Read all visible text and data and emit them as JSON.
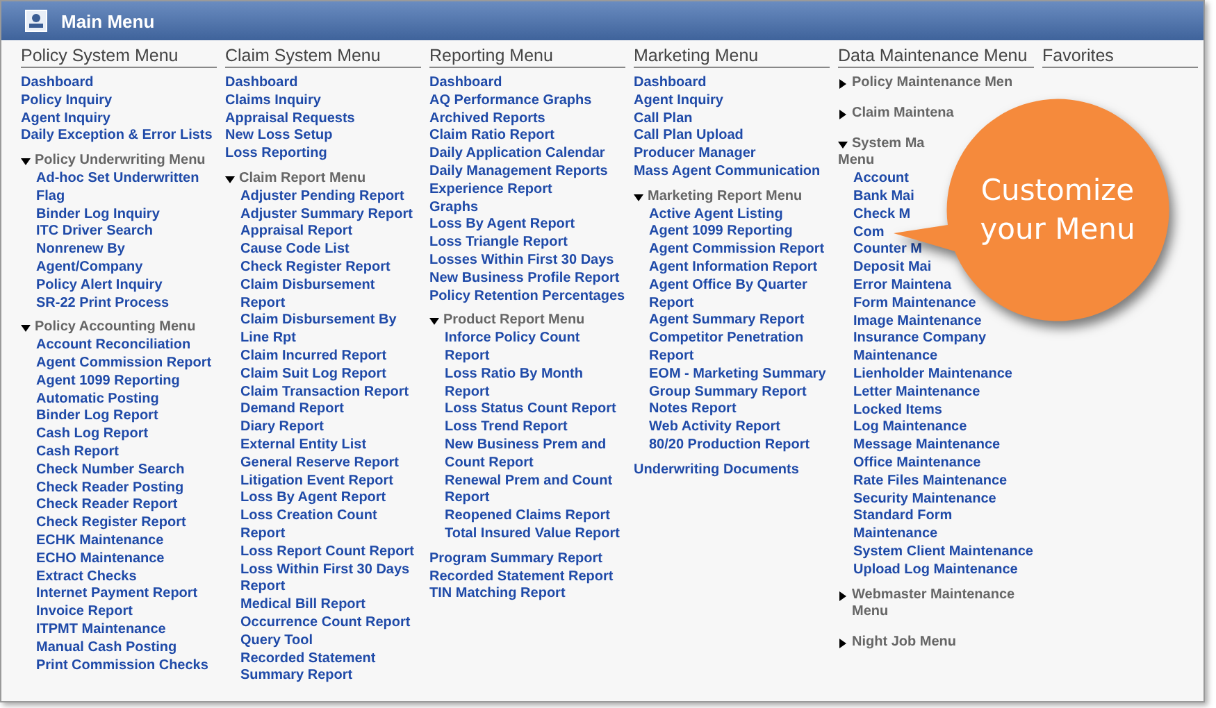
{
  "window": {
    "title": "Main Menu"
  },
  "columns": [
    {
      "title": "Policy System Menu",
      "items": [
        {
          "kind": "link",
          "label": "Dashboard"
        },
        {
          "kind": "link",
          "label": "Policy Inquiry"
        },
        {
          "kind": "link",
          "label": "Agent Inquiry"
        },
        {
          "kind": "link",
          "label": "Daily Exception & Error Lists"
        },
        {
          "kind": "submenu",
          "label": "Policy Underwriting Menu",
          "expanded": true,
          "children": [
            "Ad-hoc Set Underwritten Flag",
            "Binder Log Inquiry",
            "ITC Driver Search",
            "Nonrenew By Agent/Company",
            "Policy Alert Inquiry",
            "SR-22 Print Process"
          ]
        },
        {
          "kind": "submenu",
          "label": "Policy Accounting Menu",
          "expanded": true,
          "children": [
            "Account Reconciliation",
            "Agent Commission Report",
            "Agent 1099 Reporting",
            "Automatic Posting",
            "Binder Log Report",
            "Cash Log Report",
            "Cash Report",
            "Check Number Search",
            "Check Reader Posting",
            "Check Reader Report",
            "Check Register Report",
            "ECHK Maintenance",
            "ECHO Maintenance",
            "Extract Checks",
            "Internet Payment Report",
            "Invoice Report",
            "ITPMT Maintenance",
            "Manual Cash Posting",
            "Print Commission Checks"
          ]
        }
      ]
    },
    {
      "title": "Claim System Menu",
      "items": [
        {
          "kind": "link",
          "label": "Dashboard"
        },
        {
          "kind": "link",
          "label": "Claims Inquiry"
        },
        {
          "kind": "link",
          "label": "Appraisal Requests"
        },
        {
          "kind": "link",
          "label": "New Loss Setup"
        },
        {
          "kind": "link",
          "label": "Loss Reporting"
        },
        {
          "kind": "submenu",
          "label": "Claim Report Menu",
          "expanded": true,
          "children": [
            "Adjuster Pending Report",
            "Adjuster Summary Report",
            "Appraisal Report",
            "Cause Code List",
            "Check Register Report",
            "Claim Disbursement Report",
            "Claim Disbursement By Line Rpt",
            "Claim Incurred Report",
            "Claim Suit Log Report",
            "Claim Transaction Report",
            "Demand Report",
            "Diary Report",
            "External Entity List",
            "General Reserve Report",
            "Litigation Event Report",
            "Loss By Agent Report",
            "Loss Creation Count Report",
            "Loss Report Count Report",
            "Loss Within First 30 Days Report",
            "Medical Bill Report",
            "Occurrence Count Report",
            "Query Tool",
            "Recorded Statement",
            "Summary Report"
          ]
        }
      ]
    },
    {
      "title": "Reporting Menu",
      "items": [
        {
          "kind": "link",
          "label": "Dashboard"
        },
        {
          "kind": "link",
          "label": "AQ Performance Graphs"
        },
        {
          "kind": "link",
          "label": "Archived Reports"
        },
        {
          "kind": "link",
          "label": "Claim Ratio Report"
        },
        {
          "kind": "link",
          "label": "Daily Application Calendar"
        },
        {
          "kind": "link",
          "label": "Daily Management Reports"
        },
        {
          "kind": "link",
          "label": "Experience Report"
        },
        {
          "kind": "link",
          "label": "Graphs"
        },
        {
          "kind": "link",
          "label": "Loss By Agent Report"
        },
        {
          "kind": "link",
          "label": "Loss Triangle Report"
        },
        {
          "kind": "link",
          "label": "Losses Within First 30 Days"
        },
        {
          "kind": "link",
          "label": "New Business Profile Report"
        },
        {
          "kind": "link",
          "label": "Policy Retention Percentages"
        },
        {
          "kind": "submenu",
          "label": "Product Report Menu",
          "expanded": true,
          "children": [
            "Inforce Policy Count Report",
            "Loss Ratio By Month Report",
            "Loss Status Count Report",
            "Loss Trend Report",
            "New Business Prem and Count Report",
            "Renewal Prem and Count Report",
            "Reopened Claims Report",
            "Total Insured Value Report"
          ]
        },
        {
          "kind": "link",
          "label": "Program Summary Report"
        },
        {
          "kind": "link",
          "label": "Recorded Statement Report"
        },
        {
          "kind": "link",
          "label": "TIN Matching Report"
        }
      ]
    },
    {
      "title": "Marketing Menu",
      "items": [
        {
          "kind": "link",
          "label": "Dashboard"
        },
        {
          "kind": "link",
          "label": "Agent Inquiry"
        },
        {
          "kind": "link",
          "label": "Call Plan"
        },
        {
          "kind": "link",
          "label": "Call Plan Upload"
        },
        {
          "kind": "link",
          "label": "Producer Manager"
        },
        {
          "kind": "link",
          "label": "Mass Agent Communication"
        },
        {
          "kind": "submenu",
          "label": "Marketing Report Menu",
          "expanded": true,
          "children": [
            "Active Agent Listing",
            "Agent 1099 Reporting",
            "Agent Commission Report",
            "Agent Information Report",
            "Agent Office By Quarter Report",
            "Agent Summary Report",
            "Competitor Penetration Report",
            "EOM - Marketing Summary",
            "Group Summary Report",
            "Notes Report",
            "Web Activity Report",
            "80/20 Production Report"
          ]
        },
        {
          "kind": "link",
          "label": "Underwriting Documents"
        }
      ]
    },
    {
      "title": "Data Maintenance Menu",
      "items": [
        {
          "kind": "submenu",
          "label": "Policy Maintenance Men",
          "expanded": false
        },
        {
          "kind": "submenu",
          "label": "Claim Maintena",
          "expanded": false
        },
        {
          "kind": "submenu",
          "label": "System Ma",
          "continuation": "Menu",
          "expanded": true,
          "children": [
            "Account",
            "Bank Mai",
            "Check M",
            "Com",
            "Counter M",
            "Deposit Mai",
            "Error Maintena",
            "Form Maintenance",
            "Image Maintenance",
            "Insurance Company Maintenance",
            "Lienholder Maintenance",
            "Letter Maintenance",
            "Locked Items",
            "Log Maintenance",
            "Message Maintenance",
            "Office Maintenance",
            "Rate Files Maintenance",
            "Security Maintenance",
            "Standard Form Maintenance",
            "System Client Maintenance",
            "Upload Log Maintenance"
          ]
        },
        {
          "kind": "submenu",
          "label": "Webmaster Maintenance Menu",
          "expanded": false
        },
        {
          "kind": "submenu",
          "label": "Night Job Menu",
          "expanded": false
        }
      ]
    },
    {
      "title": "Favorites"
    }
  ],
  "callout": {
    "text": "Customize your Menu"
  }
}
